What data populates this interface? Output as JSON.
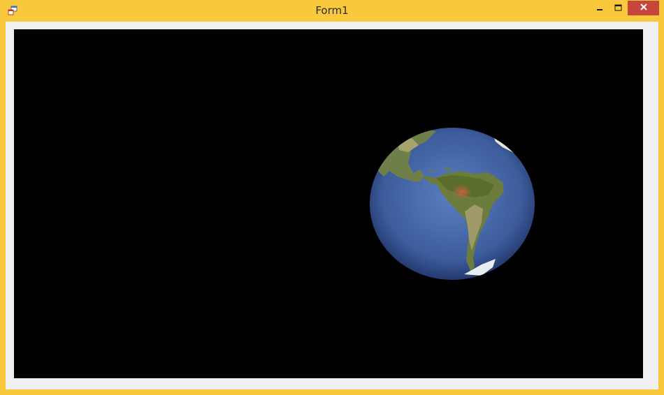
{
  "window": {
    "title": "Form1",
    "frame_color": "#fac83c",
    "close_color": "#c7463c"
  },
  "titlebar_buttons": {
    "minimize": "minimize-icon",
    "maximize": "maximize-icon",
    "close": "close-icon"
  },
  "viewport": {
    "background": "#000000",
    "content": "globe-render"
  }
}
